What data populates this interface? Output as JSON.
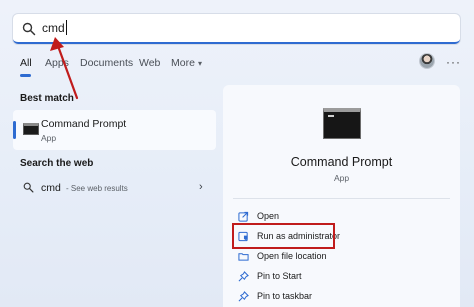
{
  "search": {
    "query": "cmd"
  },
  "tabs": [
    {
      "label": "All",
      "active": true
    },
    {
      "label": "Apps",
      "active": false
    },
    {
      "label": "Documents",
      "active": false
    },
    {
      "label": "Web",
      "active": false
    },
    {
      "label": "More",
      "active": false
    }
  ],
  "best_match": {
    "heading": "Best match",
    "title": "Command Prompt",
    "subtitle": "App"
  },
  "search_web": {
    "heading": "Search the web",
    "query": "cmd",
    "hint": "- See web results"
  },
  "preview": {
    "title": "Command Prompt",
    "subtitle": "App",
    "actions": [
      {
        "label": "Open",
        "icon": "open-icon"
      },
      {
        "label": "Run as administrator",
        "icon": "shield-icon"
      },
      {
        "label": "Open file location",
        "icon": "folder-icon"
      },
      {
        "label": "Pin to Start",
        "icon": "pin-icon"
      },
      {
        "label": "Pin to taskbar",
        "icon": "pin-icon"
      }
    ]
  },
  "colors": {
    "accent": "#2e6bd1",
    "annotation": "#c01c1c"
  }
}
